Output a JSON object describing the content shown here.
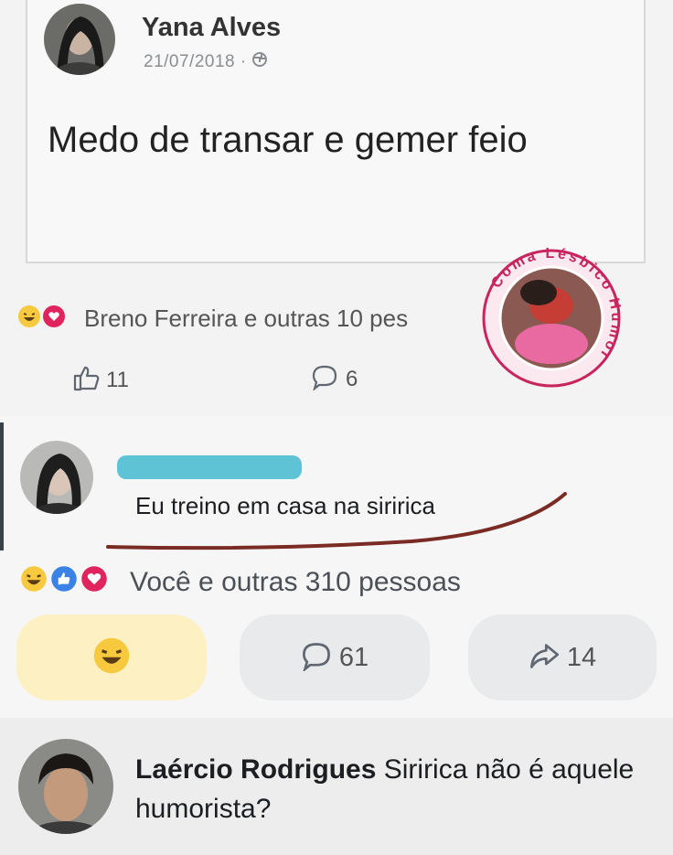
{
  "post": {
    "author": "Yana Alves",
    "date": "21/07/2018 · ",
    "privacy_icon": "globe-icon",
    "text": "Medo de transar e gemer feio",
    "reactions_text": "Breno Ferreira e outras 10 pes",
    "likes": "11",
    "comments": "6"
  },
  "stamp": {
    "text": "Coma Lésbico Humor"
  },
  "comment": {
    "text": "Eu treino em casa na siririca",
    "reactions_text": "Você e outras 310 pessoas",
    "comments_count": "61",
    "shares_count": "14"
  },
  "reply": {
    "author": "Laércio Rodrigues",
    "text": " Siririca não é aquele humorista?"
  },
  "colors": {
    "highlight": "#5fc3d6",
    "underline": "#7a2b23",
    "haha_yellow": "#f7c93e",
    "love_red": "#e0245e",
    "like_blue": "#3b82e6",
    "stamp_border": "#c8245e"
  }
}
